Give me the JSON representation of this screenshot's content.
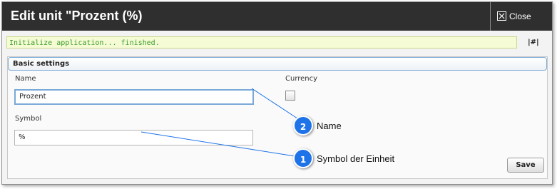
{
  "window": {
    "title": "Edit unit \"Prozent (%)",
    "close_label": "Close"
  },
  "status": {
    "message": "Initialize application... finished.",
    "hash_link": "|#|"
  },
  "panel": {
    "title": "Basic settings",
    "name_label": "Name",
    "name_value": "Prozent",
    "currency_label": "Currency",
    "currency_checked": false,
    "symbol_label": "Symbol",
    "symbol_value": "%",
    "save_label": "Save"
  },
  "callouts": [
    {
      "number": "2",
      "text": "Name"
    },
    {
      "number": "1",
      "text": "Symbol der Einheit"
    }
  ],
  "colors": {
    "titlebar": "#2f2f2f",
    "callout_bubble": "#1e73e8",
    "status_text": "#3a9c2a"
  }
}
